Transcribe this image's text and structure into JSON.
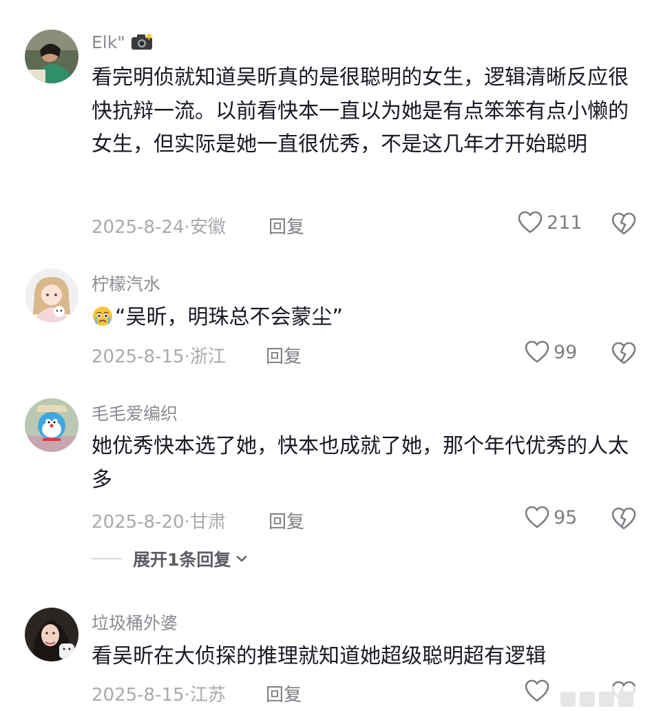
{
  "comments": [
    {
      "username": "Elk\"",
      "username_icon": "camera-flash-icon",
      "text": "看完明侦就知道吴昕真的是很聪明的女生，逻辑清晰反应很快抗辩一流。以前看快本一直以为她是有点笨笨有点小懒的女生，但实际是她一直很优秀，不是这几年才开始聪明",
      "date_location": "2025-8-24·安徽",
      "reply_label": "回复",
      "likes": "211"
    },
    {
      "username": "柠檬汽水",
      "emoji": "crying-face-icon",
      "text": "“吴昕，明珠总不会蒙尘”",
      "date_location": "2025-8-15·浙江",
      "reply_label": "回复",
      "likes": "99"
    },
    {
      "username": "毛毛爱编织",
      "text": "她优秀快本选了她，快本也成就了她，那个年代优秀的人太多",
      "date_location": "2025-8-20·甘肃",
      "reply_label": "回复",
      "likes": "95",
      "expand_label": "展开1条回复"
    },
    {
      "username": "垃圾桶外婆",
      "text": "看吴昕在大侦探的推理就知道她超级聪明超有逻辑",
      "date_location": "2025-8-15·江苏",
      "reply_label": "回复",
      "likes": ""
    }
  ],
  "colors": {
    "text": "#161823",
    "username": "#8a8b91",
    "meta": "#a8a9ae",
    "icon": "#7d7e84"
  }
}
